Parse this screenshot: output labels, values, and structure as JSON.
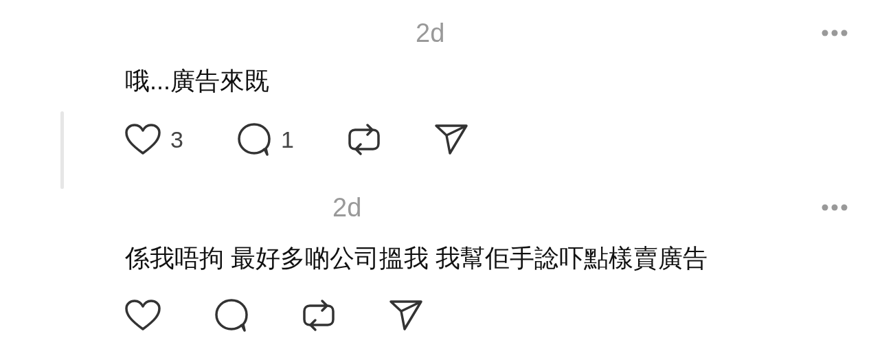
{
  "posts": [
    {
      "time": "2d",
      "text": "哦...廣告來既",
      "thread_line": true,
      "actions": [
        {
          "kind": "like",
          "count": "3"
        },
        {
          "kind": "reply",
          "count": "1"
        },
        {
          "kind": "repost"
        },
        {
          "kind": "share"
        }
      ]
    },
    {
      "time": "2d",
      "text": "係我唔拘 最好多啲公司搵我 我幫佢手諗吓點樣賣廣告",
      "thread_line": false,
      "actions": [
        {
          "kind": "like"
        },
        {
          "kind": "reply"
        },
        {
          "kind": "repost"
        },
        {
          "kind": "share"
        }
      ]
    }
  ]
}
